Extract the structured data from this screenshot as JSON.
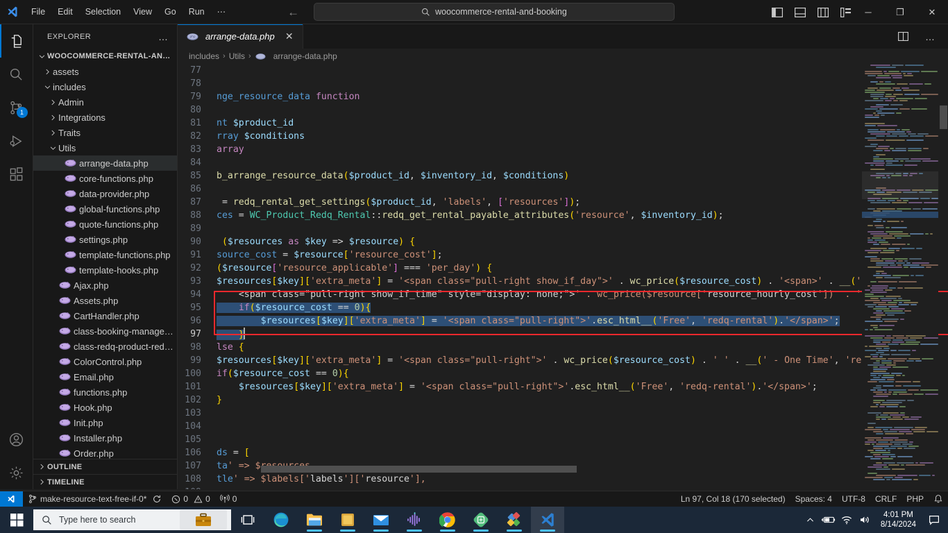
{
  "titlebar": {
    "logo_icon": "vscode-logo-icon",
    "menu": [
      "File",
      "Edit",
      "Selection",
      "View",
      "Go",
      "Run",
      "⋯"
    ],
    "back_icon": "arrow-left-icon",
    "forward_icon": "arrow-right-icon",
    "search": {
      "icon": "search-icon",
      "value": "woocommerce-rental-and-booking"
    },
    "actions": [
      "toggle-primary-sidebar-icon",
      "toggle-panel-icon",
      "toggle-secondary-sidebar-icon",
      "customize-layout-icon"
    ],
    "window_controls": {
      "minimize": "─",
      "maximize": "❐",
      "close": "✕"
    }
  },
  "activitybar": {
    "items": [
      {
        "name": "explorer",
        "icon": "files-icon",
        "active": true,
        "badge": ""
      },
      {
        "name": "search",
        "icon": "search-icon",
        "active": false,
        "badge": ""
      },
      {
        "name": "source-control",
        "icon": "source-control-icon",
        "active": false,
        "badge": "1"
      },
      {
        "name": "run-and-debug",
        "icon": "run-and-debug-icon",
        "active": false,
        "badge": ""
      },
      {
        "name": "extensions",
        "icon": "extensions-icon",
        "active": false,
        "badge": ""
      }
    ],
    "bottom": [
      {
        "name": "accounts",
        "icon": "account-icon"
      },
      {
        "name": "manage",
        "icon": "gear-icon"
      }
    ]
  },
  "sidebar": {
    "title": "EXPLORER",
    "more_icon": "ellipsis-icon",
    "root": {
      "label": "WOOCOMMERCE-RENTAL-AND-...",
      "expanded": true
    },
    "tree": [
      {
        "label": "assets",
        "type": "folder",
        "expanded": false,
        "depth": 1
      },
      {
        "label": "includes",
        "type": "folder",
        "expanded": true,
        "depth": 1
      },
      {
        "label": "Admin",
        "type": "folder",
        "expanded": false,
        "depth": 2
      },
      {
        "label": "Integrations",
        "type": "folder",
        "expanded": false,
        "depth": 2
      },
      {
        "label": "Traits",
        "type": "folder",
        "expanded": false,
        "depth": 2
      },
      {
        "label": "Utils",
        "type": "folder",
        "expanded": true,
        "depth": 2
      },
      {
        "label": "arrange-data.php",
        "type": "php",
        "depth": 3,
        "selected": true
      },
      {
        "label": "core-functions.php",
        "type": "php",
        "depth": 3
      },
      {
        "label": "data-provider.php",
        "type": "php",
        "depth": 3
      },
      {
        "label": "global-functions.php",
        "type": "php",
        "depth": 3
      },
      {
        "label": "quote-functions.php",
        "type": "php",
        "depth": 3
      },
      {
        "label": "settings.php",
        "type": "php",
        "depth": 3
      },
      {
        "label": "template-functions.php",
        "type": "php",
        "depth": 3
      },
      {
        "label": "template-hooks.php",
        "type": "php",
        "depth": 3
      },
      {
        "label": "Ajax.php",
        "type": "php",
        "depth": 2
      },
      {
        "label": "Assets.php",
        "type": "php",
        "depth": 2
      },
      {
        "label": "CartHandler.php",
        "type": "php",
        "depth": 2
      },
      {
        "label": "class-booking-manager.php",
        "type": "php",
        "depth": 2
      },
      {
        "label": "class-redq-product-redq_r...",
        "type": "php",
        "depth": 2
      },
      {
        "label": "ColorControl.php",
        "type": "php",
        "depth": 2
      },
      {
        "label": "Email.php",
        "type": "php",
        "depth": 2
      },
      {
        "label": "functions.php",
        "type": "php",
        "depth": 2
      },
      {
        "label": "Hook.php",
        "type": "php",
        "depth": 2
      },
      {
        "label": "Init.php",
        "type": "php",
        "depth": 2
      },
      {
        "label": "Installer.php",
        "type": "php",
        "depth": 2
      },
      {
        "label": "Order.php",
        "type": "php",
        "depth": 2
      }
    ],
    "sections": [
      {
        "label": "OUTLINE",
        "expanded": false
      },
      {
        "label": "TIMELINE",
        "expanded": false
      }
    ]
  },
  "editor": {
    "tab": {
      "label": "arrange-data.php",
      "icon": "php-file-icon",
      "close_icon": "close-icon",
      "dirty": false,
      "italic": true
    },
    "tab_actions": [
      "split-editor-icon",
      "more-actions-icon"
    ],
    "breadcrumb": [
      "includes",
      "Utils",
      "arrange-data.php"
    ],
    "breadcrumb_separator": "›",
    "first_visible_line": 77,
    "lines": [
      {
        "n": 77,
        "text": ""
      },
      {
        "n": 78,
        "text": ""
      },
      {
        "n": 79,
        "text": "nge_resource_data function"
      },
      {
        "n": 80,
        "text": ""
      },
      {
        "n": 81,
        "text": "nt $product_id"
      },
      {
        "n": 82,
        "text": "rray $conditions"
      },
      {
        "n": 83,
        "text": "array"
      },
      {
        "n": 84,
        "text": ""
      },
      {
        "n": 85,
        "text": "b_arrange_resource_data($product_id, $inventory_id, $conditions)"
      },
      {
        "n": 86,
        "text": ""
      },
      {
        "n": 87,
        "text": " = redq_rental_get_settings($product_id, 'labels', ['resources']);"
      },
      {
        "n": 88,
        "text": "ces = WC_Product_Redq_Rental::redq_get_rental_payable_attributes('resource', $inventory_id);"
      },
      {
        "n": 89,
        "text": ""
      },
      {
        "n": 90,
        "text": " ($resources as $key => $resource) {"
      },
      {
        "n": 91,
        "text": "source_cost = $resource['resource_cost'];"
      },
      {
        "n": 92,
        "text": "($resource['resource_applicable'] === 'per_day') {"
      },
      {
        "n": 93,
        "text": "$resources[$key]['extra_meta'] = '<span class=\"pull-right show_if_day\">' . wc_price($resource_cost) . '<span>' . __('"
      },
      {
        "n": 94,
        "text": "    <span class=\"pull-right show_if_time\" style=\"display: none;\">' . wc_price($resource['resource_hourly_cost'])  . '"
      },
      {
        "n": 95,
        "text": "    if($resource_cost == 0){",
        "selected": true
      },
      {
        "n": 96,
        "text": "        $resources[$key]['extra_meta'] = '<span class=\"pull-right\">'.esc_html__('Free', 'redq-rental').'</span>';",
        "selected": true
      },
      {
        "n": 97,
        "text": "    }",
        "selected": true,
        "cursor": true
      },
      {
        "n": 98,
        "text": "lse {"
      },
      {
        "n": 99,
        "text": "$resources[$key]['extra_meta'] = '<span class=\"pull-right\">' . wc_price($resource_cost) . ' ' . __(' - One Time', 're"
      },
      {
        "n": 100,
        "text": "if($resource_cost == 0){"
      },
      {
        "n": 101,
        "text": "    $resources[$key]['extra_meta'] = '<span class=\"pull-right\">'.esc_html__('Free', 'redq-rental').'</span>';"
      },
      {
        "n": 102,
        "text": "}"
      },
      {
        "n": 103,
        "text": ""
      },
      {
        "n": 104,
        "text": ""
      },
      {
        "n": 105,
        "text": ""
      },
      {
        "n": 106,
        "text": "ds = ["
      },
      {
        "n": 107,
        "text": "ta' => $resources,"
      },
      {
        "n": 108,
        "text": "tle' => $labels['labels']['resource'],"
      },
      {
        "n": 109,
        "text": ""
      }
    ],
    "annotation": {
      "type": "red-rectangle",
      "color": "#f0282d",
      "covers_lines": "95-97"
    }
  },
  "statusbar": {
    "remote_icon": "remote-window-icon",
    "branch_icon": "source-control-branch-icon",
    "branch": "make-resource-text-free-if-0*",
    "sync_icon": "sync-icon",
    "error_icon": "error-icon",
    "errors": "0",
    "warning_icon": "warning-icon",
    "warnings": "0",
    "ports_icon": "radio-tower-icon",
    "ports": "0",
    "cursor_position": "Ln 97, Col 18 (170 selected)",
    "indentation": "Spaces: 4",
    "encoding": "UTF-8",
    "eol": "CRLF",
    "language": "PHP",
    "bell_icon": "bell-icon"
  },
  "taskbar": {
    "start_icon": "windows-start-icon",
    "search": {
      "icon": "search-icon",
      "placeholder": "Type here to search",
      "widget_icon": "briefcase-icon"
    },
    "items": [
      {
        "name": "task-view",
        "icon": "task-view-icon"
      },
      {
        "name": "microsoft-edge",
        "icon": "edge-icon",
        "running": true
      },
      {
        "name": "file-explorer",
        "icon": "folder-icon",
        "running": true
      },
      {
        "name": "sticky-note",
        "icon": "note-icon",
        "running": true
      },
      {
        "name": "mail",
        "icon": "mail-icon",
        "running": true
      },
      {
        "name": "audio-editor",
        "icon": "waveform-icon",
        "running": true
      },
      {
        "name": "google-chrome",
        "icon": "chrome-icon",
        "running": true
      },
      {
        "name": "local-server",
        "icon": "local-icon",
        "running": true
      },
      {
        "name": "paint",
        "icon": "paint-icon",
        "running": true
      },
      {
        "name": "visual-studio-code",
        "icon": "vscode-icon",
        "running": true,
        "active": true
      }
    ],
    "tray": {
      "chevron_icon": "chevron-up-icon",
      "battery_icon": "battery-charging-icon",
      "wifi_icon": "wifi-icon",
      "volume_icon": "volume-icon",
      "time": "4:01 PM",
      "date": "8/14/2024",
      "notification_icon": "notification-icon"
    }
  },
  "colors": {
    "accent": "#0078d4",
    "annotation": "#f0282d",
    "selection": "#2d4f76",
    "editor_bg": "#1f1f1f",
    "chrome_bg": "#181818",
    "taskbar_bg": "#1b2838"
  }
}
